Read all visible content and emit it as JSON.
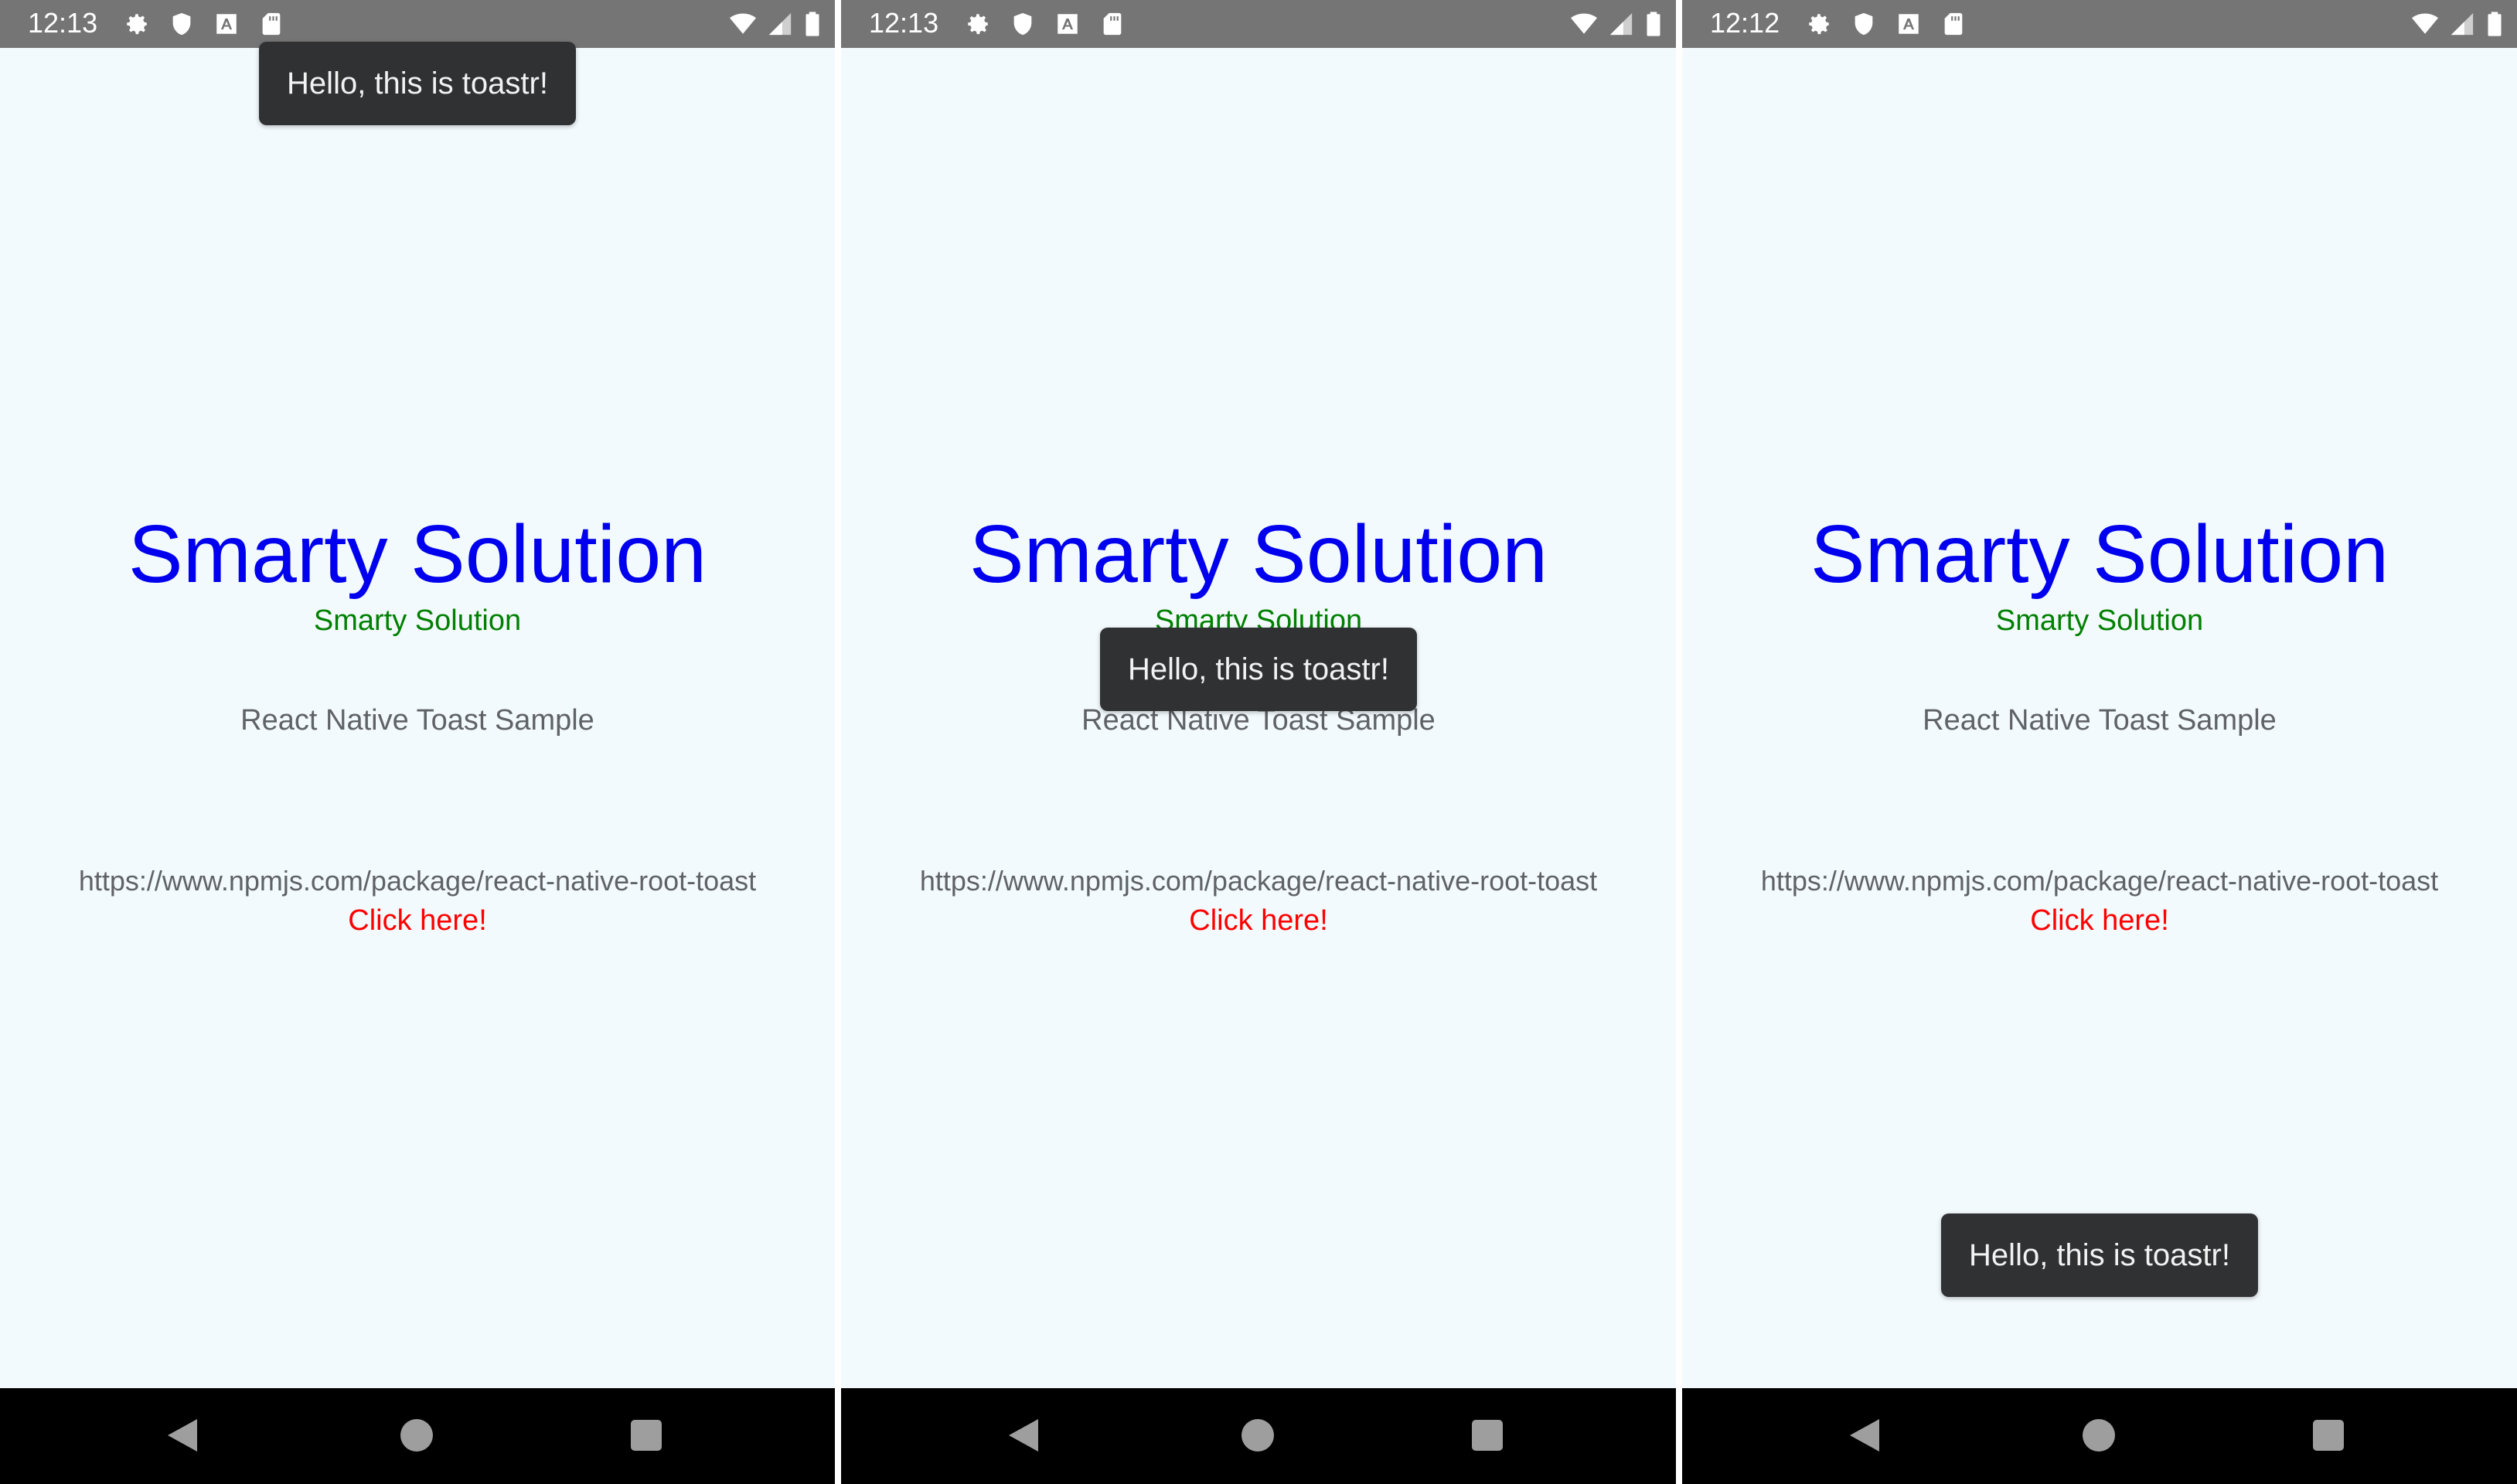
{
  "screens": [
    {
      "status_time": "12:13",
      "title": "Smarty Solution",
      "subtitle": "Smarty Solution",
      "sample_text": "React Native Toast Sample",
      "url_text": "https://www.npmjs.com/package/react-native-root-toast",
      "link_text": "Click here!",
      "toast": {
        "message": "Hello, this is toastr!",
        "position": "top"
      }
    },
    {
      "status_time": "12:13",
      "title": "Smarty Solution",
      "subtitle": "Smarty Solution",
      "sample_text": "React Native Toast Sample",
      "url_text": "https://www.npmjs.com/package/react-native-root-toast",
      "link_text": "Click here!",
      "toast": {
        "message": "Hello, this is toastr!",
        "position": "center"
      }
    },
    {
      "status_time": "12:12",
      "title": "Smarty Solution",
      "subtitle": "Smarty Solution",
      "sample_text": "React Native Toast Sample",
      "url_text": "https://www.npmjs.com/package/react-native-root-toast",
      "link_text": "Click here!",
      "toast": {
        "message": "Hello, this is toastr!",
        "position": "bottom"
      }
    }
  ],
  "status_icons": [
    "gear-icon",
    "shield-icon",
    "font-icon",
    "sd-card-icon",
    "wifi-icon",
    "signal-icon",
    "battery-icon"
  ],
  "nav_icons": [
    "back-icon",
    "home-icon",
    "recents-icon"
  ],
  "colors": {
    "title": "#0000ee",
    "subtitle": "#008000",
    "link": "#ff0000",
    "toast_bg": "#2f3133",
    "status_bar": "#757575",
    "background": "#f3fafd"
  }
}
